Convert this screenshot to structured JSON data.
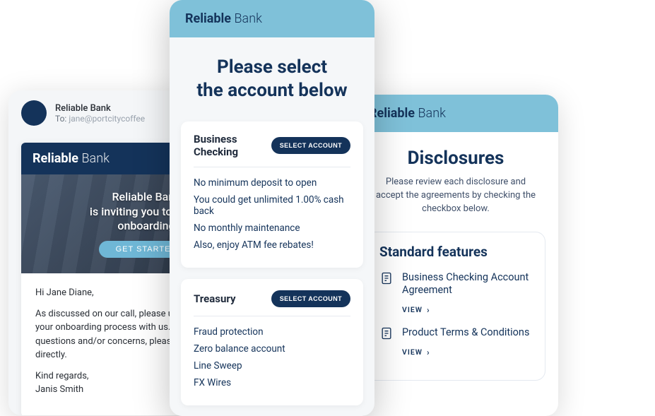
{
  "brand": {
    "part1": "Reliable",
    "part2": "Bank",
    "full": "Reliable Bank"
  },
  "email": {
    "from": "Reliable Bank",
    "to_label": "To:",
    "to_addr": "jane@portcitycoffee",
    "hero": {
      "line1": "Reliable Bank",
      "line2": "is inviting you to begin",
      "line3": "onboarding",
      "cta": "GET STARTED"
    },
    "greeting": "Hi Jane Diane,",
    "body": "As discussed on our call, please use the link to begin your onboarding process with us. If you have any questions and/or concerns, please reply to this email directly.",
    "signoff": "Kind regards,",
    "sender": "Janis Smith"
  },
  "select": {
    "heading_line1": "Please select",
    "heading_line2": "the account below",
    "select_label": "SELECT ACCOUNT",
    "options": [
      {
        "title": "Business Checking",
        "features": [
          "No minimum deposit to open",
          "You could get unlimited 1.00% cash back",
          "No monthly maintenance",
          "Also, enjoy ATM fee rebates!"
        ]
      },
      {
        "title": "Treasury",
        "features": [
          "Fraud protection",
          "Zero balance account",
          "Line Sweep",
          "FX Wires"
        ]
      }
    ]
  },
  "disclosures": {
    "title": "Disclosures",
    "subtitle": "Please review each disclosure and accept the agreements by checking the checkbox below.",
    "panel_title": "Standard features",
    "view_label": "VIEW",
    "docs": [
      {
        "title": "Business Checking Account Agreement"
      },
      {
        "title": "Product Terms & Conditions"
      }
    ]
  }
}
